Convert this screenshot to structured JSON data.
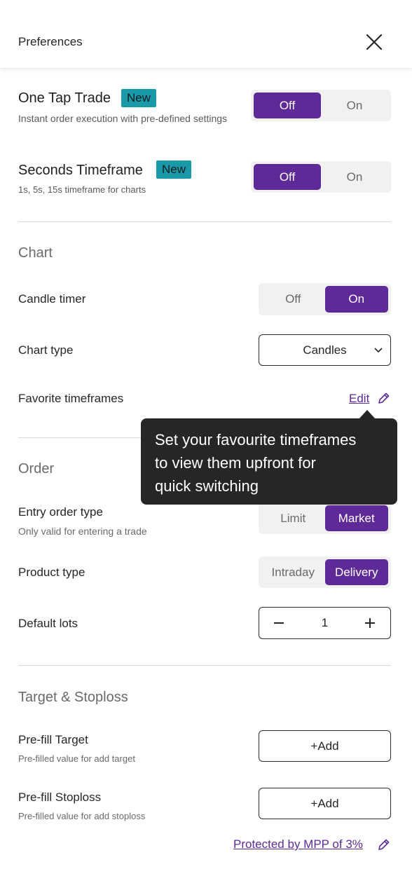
{
  "header": {
    "title": "Preferences"
  },
  "one_tap": {
    "title": "One Tap Trade",
    "badge": "New",
    "subtitle": "Instant order execution with pre-defined settings",
    "options": [
      "Off",
      "On"
    ],
    "selected": "Off"
  },
  "seconds_tf": {
    "title": "Seconds Timeframe",
    "badge": "New",
    "subtitle": "1s, 5s, 15s timeframe for charts",
    "options": [
      "Off",
      "On"
    ],
    "selected": "Off"
  },
  "chart": {
    "section_title": "Chart",
    "candle_timer": {
      "label": "Candle timer",
      "options": [
        "Off",
        "On"
      ],
      "selected": "On"
    },
    "chart_type": {
      "label": "Chart type",
      "value": "Candles"
    },
    "favorite_tf": {
      "label": "Favorite timeframes",
      "edit": "Edit"
    }
  },
  "tooltip": {
    "line1": "Set your favourite timeframes",
    "line2": "to view them upfront for",
    "line3": "quick switching"
  },
  "order": {
    "section_title": "Order",
    "entry_type": {
      "label": "Entry order type",
      "sublabel": "Only valid for entering a trade",
      "options": [
        "Limit",
        "Market"
      ],
      "selected": "Market"
    },
    "product_type": {
      "label": "Product type",
      "options": [
        "Intraday",
        "Delivery"
      ],
      "selected": "Delivery"
    },
    "default_lots": {
      "label": "Default lots",
      "value": "1"
    }
  },
  "target_stoploss": {
    "section_title": "Target & Stoploss",
    "target": {
      "label": "Pre-fill Target",
      "sublabel": "Pre-filled value for add target",
      "button": "+Add"
    },
    "stoploss": {
      "label": "Pre-fill Stoploss",
      "sublabel": "Pre-filled value for add stoploss",
      "button": "+Add"
    },
    "mpp_link": "Protected by MPP of 3%"
  },
  "colors": {
    "accent": "#5e2a98",
    "badge": "#1a9aa8",
    "tooltip_bg": "#262626"
  }
}
